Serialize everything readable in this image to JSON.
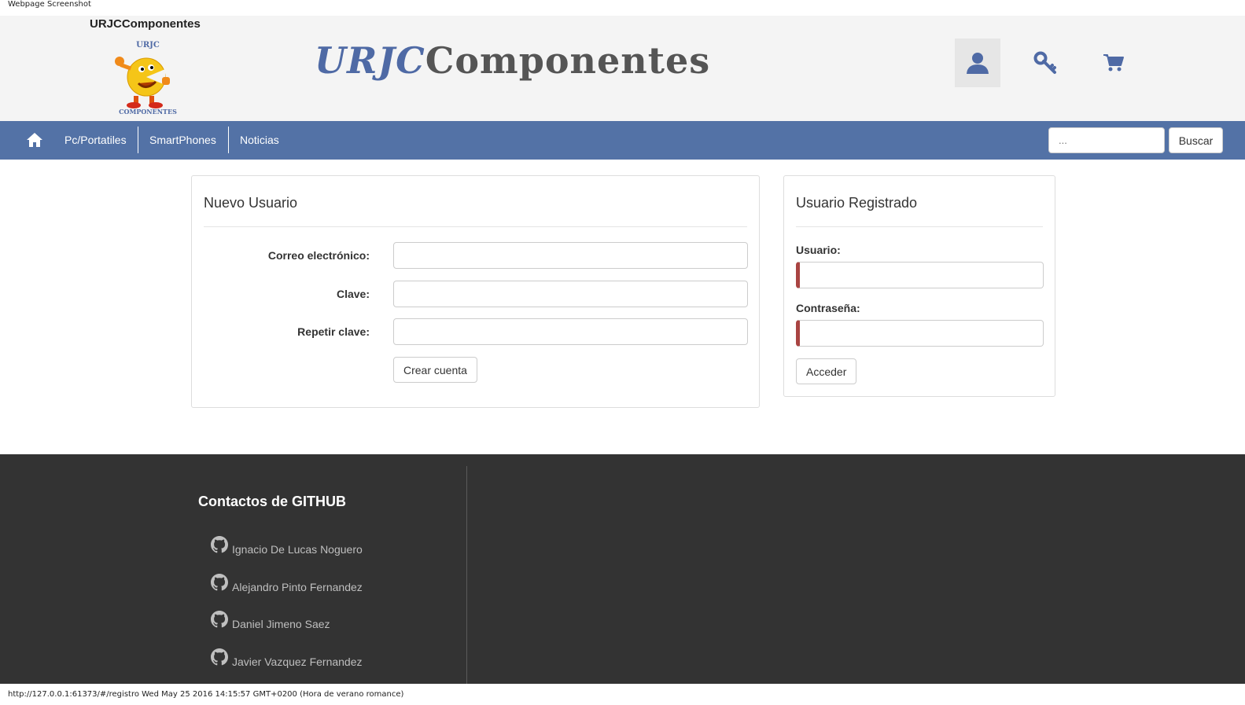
{
  "screenshot_label": "Webpage Screenshot",
  "header": {
    "site_name": "URJCComponentes",
    "brand_part1": "URJC",
    "brand_part2": "Componentes",
    "logo_text_top": "URJC",
    "logo_text_bottom": "COMPONENTES",
    "icons": [
      "user-icon",
      "key-icon",
      "cart-icon"
    ]
  },
  "nav": {
    "items": [
      "Pc/Portatiles",
      "SmartPhones",
      "Noticias"
    ],
    "search_placeholder": "...",
    "search_button": "Buscar"
  },
  "new_user": {
    "title": "Nuevo Usuario",
    "email_label": "Correo electrónico:",
    "password_label": "Clave:",
    "repeat_label": "Repetir clave:",
    "submit": "Crear cuenta"
  },
  "registered_user": {
    "title": "Usuario Registrado",
    "user_label": "Usuario:",
    "password_label": "Contraseña:",
    "submit": "Acceder"
  },
  "footer": {
    "contacts_title": "Contactos de GITHUB",
    "contacts": [
      "Ignacio De Lucas Noguero",
      "Alejandro Pinto Fernandez",
      "Daniel Jimeno Saez",
      "Javier Vazquez Fernandez"
    ]
  },
  "status_line": "http://127.0.0.1:61373/#/registro Wed May 25 2016 14:15:57 GMT+0200 (Hora de verano romance)",
  "colors": {
    "nav": "#5372a6",
    "dark_footer": "#333333",
    "invalid_border": "#a94442",
    "brand_blue": "#4f6aa5"
  }
}
